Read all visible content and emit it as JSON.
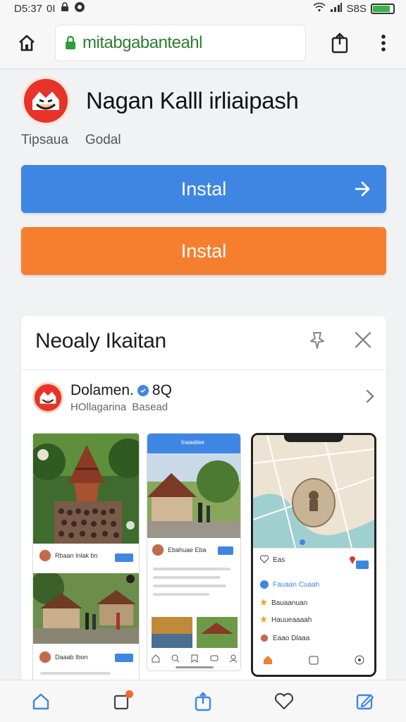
{
  "status": {
    "time": "D5:37",
    "carrier": "0I",
    "battery_text": "S8S",
    "battery_level": 0.85,
    "icons": [
      "lock-icon",
      "notification-icon",
      "wifi-icon",
      "signal-icon",
      "battery-icon"
    ]
  },
  "browser": {
    "url": "mitabgabanteahl",
    "home_icon": "home-icon",
    "secure_icon": "lock-icon",
    "share_icon": "share-icon",
    "menu_icon": "more-vertical-icon"
  },
  "app": {
    "title": "Nagan Kalll irliaipash",
    "meta_left": "Tipsaua",
    "meta_right": "Godal"
  },
  "buttons": {
    "primary_label": "Instal",
    "secondary_label": "Instal"
  },
  "card": {
    "title": "Neoaly Ikaitan",
    "developer_name": "Dolamen.",
    "developer_extra": "8Q",
    "developer_sub_a": "HOllagarina",
    "developer_sub_b": "Basead"
  },
  "screenshots": {
    "shot1_row1": "Rbaan Inlak bn",
    "shot1_row2": "Daaab Ibon",
    "shot2_header": "Inaaatiee",
    "shot2_row": "Ebahuae Eba",
    "shot3_top": "Eas",
    "shot3_row1": "Fauaan Cuaah",
    "shot3_row2": "Bauaanuan",
    "shot3_row3": "Hauueaaaah",
    "shot3_row4": "Eaao Dlaaa"
  },
  "colors": {
    "primary": "#3f86e3",
    "secondary": "#f57f2f",
    "secure": "#2e7d32",
    "brand": "#e8332a"
  }
}
